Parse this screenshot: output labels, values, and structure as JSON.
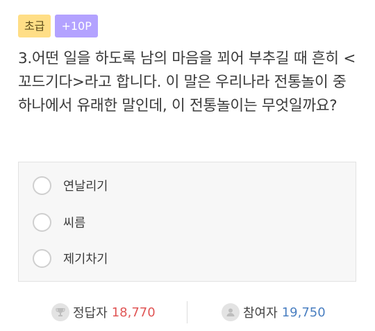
{
  "badges": {
    "level": "초급",
    "points": "+10P"
  },
  "question": {
    "text": "3.어떤 일을 하도록 남의 마음을 꾀어 부추길 때 흔히 <꼬드기다>라고 합니다. 이 말은 우리나라 전통놀이 중 하나에서 유래한 말인데, 이 전통놀이는 무엇일까요?"
  },
  "options": [
    {
      "label": "연날리기"
    },
    {
      "label": "씨름"
    },
    {
      "label": "제기차기"
    }
  ],
  "stats": {
    "correct_label": "정답자",
    "correct_value": "18,770",
    "participants_label": "참여자",
    "participants_value": "19,750"
  },
  "colors": {
    "level_badge": "#ffde86",
    "points_badge": "#b3a2ff",
    "correct_value": "#e05555",
    "participants_value": "#4a7fc1"
  },
  "icons": {
    "correct": "trophy-icon",
    "participants": "user-icon"
  }
}
